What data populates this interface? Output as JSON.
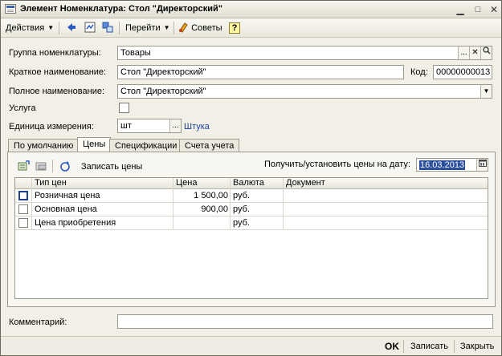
{
  "window": {
    "title": "Элемент Номенклатура: Стол \"Директорский\""
  },
  "toolbar": {
    "actions_label": "Действия",
    "goto_label": "Перейти",
    "tips_label": "Советы",
    "help_label": "?"
  },
  "form": {
    "group_label": "Группа номенклатуры:",
    "group_value": "Товары",
    "short_name_label": "Краткое наименование:",
    "short_name_value": "Стол \"Директорский\"",
    "code_label": "Код:",
    "code_value": "00000000013",
    "full_name_label": "Полное наименование:",
    "full_name_value": "Стол \"Директорский\"",
    "service_label": "Услуга",
    "unit_label": "Единица измерения:",
    "unit_value": "шт",
    "unit_link": "Штука",
    "comment_label": "Комментарий:",
    "comment_value": ""
  },
  "tabs": [
    {
      "label": "По умолчанию"
    },
    {
      "label": "Цены"
    },
    {
      "label": "Спецификации"
    },
    {
      "label": "Счета учета"
    }
  ],
  "prices": {
    "write_label": "Записать цены",
    "date_label": "Получить/установить цены на дату:",
    "date_value": "16.03.2013",
    "columns": [
      "Тип цен",
      "Цена",
      "Валюта",
      "Документ"
    ],
    "rows": [
      {
        "type": "Розничная цена",
        "price": "1 500,00",
        "currency": "руб.",
        "doc": ""
      },
      {
        "type": "Основная цена",
        "price": "900,00",
        "currency": "руб.",
        "doc": ""
      },
      {
        "type": "Цена приобретения",
        "price": "",
        "currency": "руб.",
        "doc": ""
      }
    ]
  },
  "footer": {
    "ok_label": "OK",
    "save_label": "Записать",
    "close_label": "Закрыть"
  }
}
